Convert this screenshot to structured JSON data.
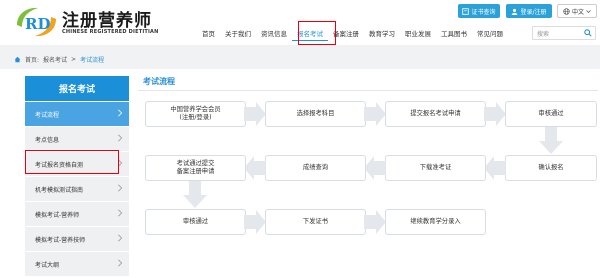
{
  "brand": {
    "logo_letters": "RD",
    "name_cn": "注册营养师",
    "name_en": "CHINESE REGISTERED DIETITIAN",
    "accent": "#1c8fd9"
  },
  "topbar": {
    "cert_query": "证书查询",
    "login": "登录/注册",
    "language": "中文"
  },
  "nav": {
    "items": [
      "首页",
      "关于我们",
      "资讯信息",
      "报名考试",
      "备案注册",
      "教育学习",
      "职业发展",
      "工具图书",
      "常见问题"
    ],
    "active_index": 3,
    "search_placeholder": "搜索"
  },
  "breadcrumb": {
    "home": "首页:",
    "section": "报名考试",
    "sep": ">",
    "current": "考试流程"
  },
  "sidebar": {
    "title": "报名考试",
    "items": [
      "考试流程",
      "考点信息",
      "考试报名资格自测",
      "机考模拟测试指南",
      "模拟考试-营养师",
      "模拟考试-营养技师",
      "考试大纲"
    ],
    "active_index": 0
  },
  "main": {
    "title": "考试流程",
    "steps": [
      {
        "text": "中国营养学会会员\n(注册/登录)"
      },
      {
        "text": "选择报考科目"
      },
      {
        "text": "提交报名考试申请"
      },
      {
        "text": "审核通过"
      },
      {
        "text": "确认报名"
      },
      {
        "text": "下载准考证"
      },
      {
        "text": "成绩查询"
      },
      {
        "text": "考试通过提交\n备案注册申请"
      },
      {
        "text": "审核通过"
      },
      {
        "text": "下发证书"
      },
      {
        "text": "继续教育学分录入"
      }
    ]
  }
}
